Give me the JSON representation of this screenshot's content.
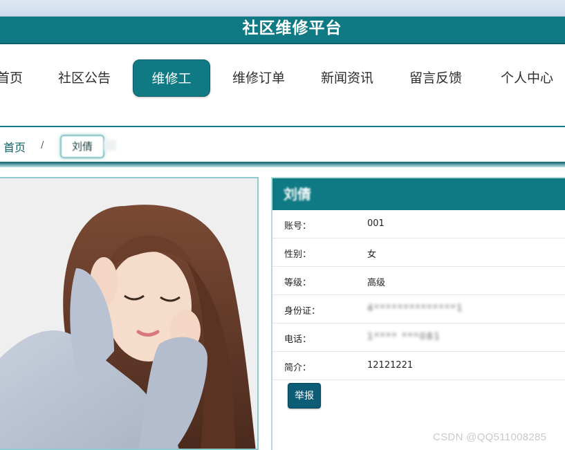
{
  "header": {
    "title": "社区维修平台"
  },
  "nav": {
    "items": [
      "首页",
      "社区公告",
      "维修工",
      "维修订单",
      "新闻资讯",
      "留言反馈",
      "个人中心"
    ],
    "active_index": 2
  },
  "breadcrumb": {
    "home": "首页",
    "separator": "/",
    "current": "刘倩"
  },
  "profile": {
    "name": "刘倩",
    "fields": [
      {
        "label": "账号：",
        "value": "001"
      },
      {
        "label": "性别：",
        "value": "女"
      },
      {
        "label": "等级：",
        "value": "高级"
      },
      {
        "label": "身份证：",
        "value": "4**************1"
      },
      {
        "label": "电话：",
        "value": "1**** ***081"
      },
      {
        "label": "简介：",
        "value": "12121221"
      }
    ],
    "report_button": "举报"
  },
  "watermark": "CSDN @QQ511008285",
  "colors": {
    "primary": "#0f7a84",
    "button": "#0d5c75"
  }
}
